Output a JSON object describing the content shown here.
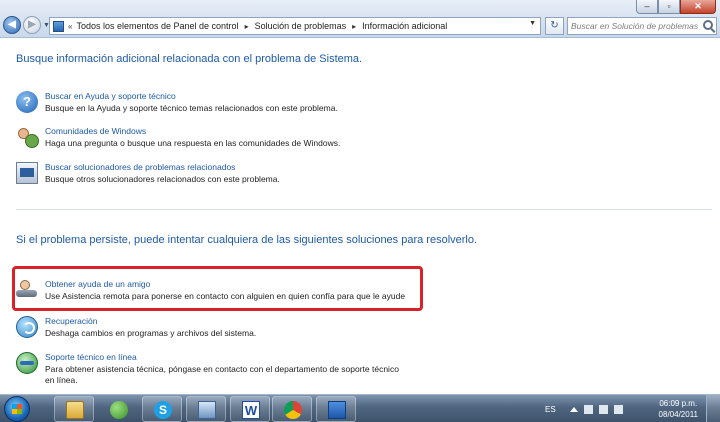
{
  "window": {
    "minimize_glyph": "–",
    "maximize_glyph": "▫",
    "close_glyph": "✕"
  },
  "nav": {
    "back_glyph": "◀",
    "forward_glyph": "▶",
    "dropdown_glyph": "▼"
  },
  "address": {
    "prefix_glyph": "«",
    "crumbs": [
      "Todos los elementos de Panel de control",
      "Solución de problemas",
      "Información adicional"
    ],
    "separator_glyph": "▸",
    "dropdown_glyph": "▼",
    "refresh_glyph": "↻"
  },
  "search": {
    "placeholder": "Buscar en Solución de problemas"
  },
  "section1": {
    "heading": "Busque información adicional relacionada con el problema de Sistema.",
    "items": [
      {
        "icon": "help-icon",
        "title": "Buscar en Ayuda y soporte técnico",
        "description": "Busque en la Ayuda y soporte técnico temas relacionados con este problema."
      },
      {
        "icon": "community-icon",
        "title": "Comunidades de Windows",
        "description": "Haga una pregunta o busque una respuesta en las comunidades de Windows."
      },
      {
        "icon": "troubleshooter-icon",
        "title": "Buscar solucionadores de problemas relacionados",
        "description": "Busque otros solucionadores relacionados con este problema."
      }
    ]
  },
  "section2": {
    "heading": "Si el problema persiste, puede intentar cualquiera de las siguientes soluciones para resolverlo.",
    "items": [
      {
        "icon": "friend-icon",
        "title": "Obtener ayuda de un amigo",
        "description": "Use Asistencia remota para ponerse en contacto con alguien en quien confía para que le ayude"
      },
      {
        "icon": "recovery-icon",
        "title": "Recuperación",
        "description": "Deshaga cambios en programas y archivos del sistema."
      },
      {
        "icon": "online-support-icon",
        "title": "Soporte técnico en línea",
        "description": "Para obtener asistencia técnica, póngase en contacto con el departamento de soporte técnico en línea."
      }
    ]
  },
  "help_glyph": "?",
  "taskbar": {
    "apps": [
      "explorer",
      "messenger",
      "skype",
      "control-panel",
      "word",
      "chrome",
      "folder"
    ],
    "app_glyphs": {
      "skype": "S",
      "word": "W"
    },
    "language": "ES",
    "time": "06:09 p.m.",
    "date": "08/04/2011"
  },
  "colors": {
    "link": "#1e5aa8",
    "highlight": "#d9232a"
  }
}
